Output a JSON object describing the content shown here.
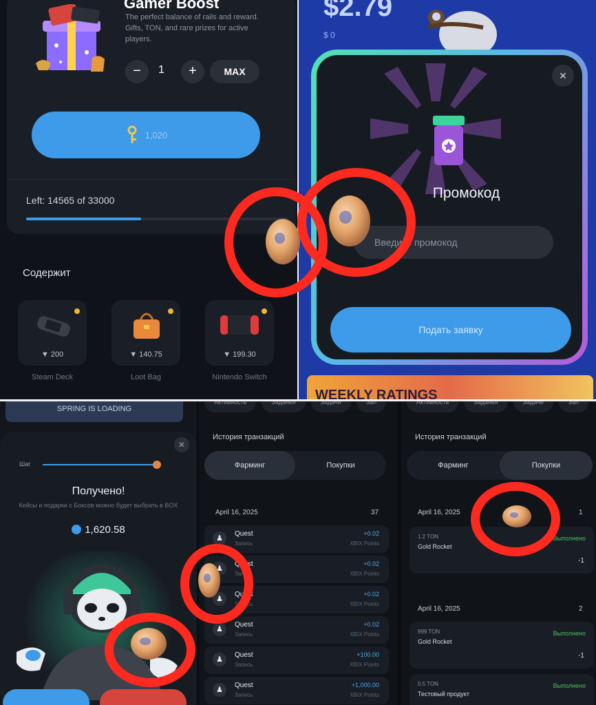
{
  "colors": {
    "accent": "#3d9be9",
    "annotation": "#ff2a1f",
    "success": "#4cc15a",
    "coin": "#f2b434"
  },
  "box": {
    "title": "Gamer Boost",
    "description": "The perfect balance of rails and reward. Gifts, TON, and rare prizes for active players.",
    "quantity": "1",
    "minus": "−",
    "plus": "+",
    "max_label": "MAX",
    "buy_label": "1,020",
    "left_text": "Left: 14565 of 33000",
    "progress": 0.44,
    "contents_label": "Содержит",
    "items": [
      {
        "name": "Steam Deck",
        "price": "▼ 200",
        "icon": "steam-deck-icon"
      },
      {
        "name": "Loot Bag",
        "price": "▼ 140.75",
        "icon": "loot-bag-icon"
      },
      {
        "name": "Nintendo Switch",
        "price": "▼ 199.30",
        "icon": "nintendo-switch-icon"
      }
    ]
  },
  "promo": {
    "balance": "$2.79",
    "balance_sub": "$ 0",
    "close": "✕",
    "title": "Промокод",
    "placeholder": "Введите промокод",
    "submit": "Подать заявку",
    "banner": "WEEKLY RATINGS"
  },
  "received": {
    "top_banner": "SPRING IS LOADING",
    "close": "✕",
    "step_label": "Шаг",
    "title": "Получено!",
    "subtitle": "Кейсы и подарки с Боксов можно будет выбрать в BOX",
    "amount": "1,620.58"
  },
  "history_left": {
    "chips": [
      "Активность",
      "Заданья",
      "Задачи",
      "Зап"
    ],
    "section_title": "История транзакций",
    "tabs": [
      "Фарминг",
      "Покупки"
    ],
    "active_tab": 0,
    "date": "April 16, 2025",
    "count": "37",
    "rows": [
      {
        "icon": "♟",
        "title": "Quest",
        "sub": "Запись",
        "amount": "+0.02",
        "note": "XBIX Points"
      },
      {
        "icon": "♟",
        "title": "Quest",
        "sub": "Запись",
        "amount": "+0.02",
        "note": "XBIX Points"
      },
      {
        "icon": "♟",
        "title": "Quest",
        "sub": "Запись",
        "amount": "+0.02",
        "note": "XBIX Points"
      },
      {
        "icon": "♟",
        "title": "Quest",
        "sub": "Запись",
        "amount": "+0.02",
        "note": "XBIX Points"
      },
      {
        "icon": "♟",
        "title": "Quest",
        "sub": "Запись",
        "amount": "+100.00",
        "note": "XBIX Points"
      },
      {
        "icon": "♟",
        "title": "Quest",
        "sub": "Запись",
        "amount": "+1,000.00",
        "note": "XBIX Points"
      }
    ]
  },
  "history_right": {
    "chips": [
      "Активность",
      "Заданья",
      "Задачи",
      "Зап"
    ],
    "section_title": "История транзакций",
    "tabs": [
      "Фарминг",
      "Покупки"
    ],
    "active_tab": 1,
    "groups": [
      {
        "date": "April 16, 2025",
        "count": "1",
        "rows": [
          {
            "t1": "1.2 TON",
            "t2": "Gold Rocket",
            "status": "Выполнено",
            "qty": "-1"
          }
        ]
      },
      {
        "date": "April 16, 2025",
        "count": "2",
        "rows": [
          {
            "t1": "999 TON",
            "t2": "Gold Rocket",
            "status": "Выполнено",
            "qty": "-1"
          },
          {
            "t1": "0.5 TON",
            "t2": "Тестовый продукт",
            "status": "Выполнено",
            "qty": ""
          }
        ]
      }
    ]
  }
}
